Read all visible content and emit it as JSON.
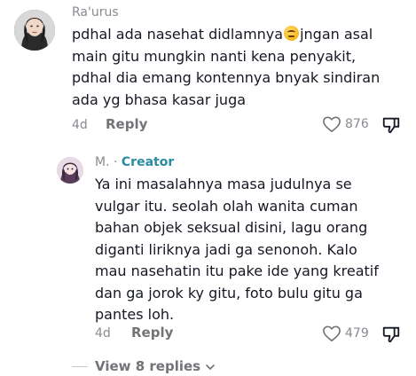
{
  "comments": [
    {
      "author": "Ra'urus",
      "lines": [
        "pdhal ada nasehat didlamnya",
        "jngan asal",
        "main gitu mungkin nanti kena penyakit,",
        "pdhal dia emang kontennya bnyak sindiran",
        "ada yg bhasa kasar juga"
      ],
      "date": "4d",
      "reply_label": "Reply",
      "likes": "876"
    },
    {
      "author": "M.",
      "author_separator": " · ",
      "badge": "Creator",
      "lines": [
        "Ya ini masalahnya masa judulnya se",
        "vulgar itu. seolah olah wanita cuman",
        "bahan objek seksual disini, lagu orang",
        "diganti liriknya jadi ga senonoh. Kalo",
        "mau nasehatin itu pake ide yang kreatif",
        "dan ga jorok ky gitu, foto bulu gitu ga",
        "pantes loh."
      ],
      "date": "4d",
      "reply_label": "Reply",
      "likes": "479"
    }
  ],
  "view_replies_label": "View 8 replies",
  "colors": {
    "creator_badge": "#2a8ca3",
    "muted": "#8a8b91",
    "text": "#161823"
  },
  "icons": [
    "heart-icon",
    "dislike-icon",
    "chevron-down-icon",
    "emoji-icon"
  ]
}
